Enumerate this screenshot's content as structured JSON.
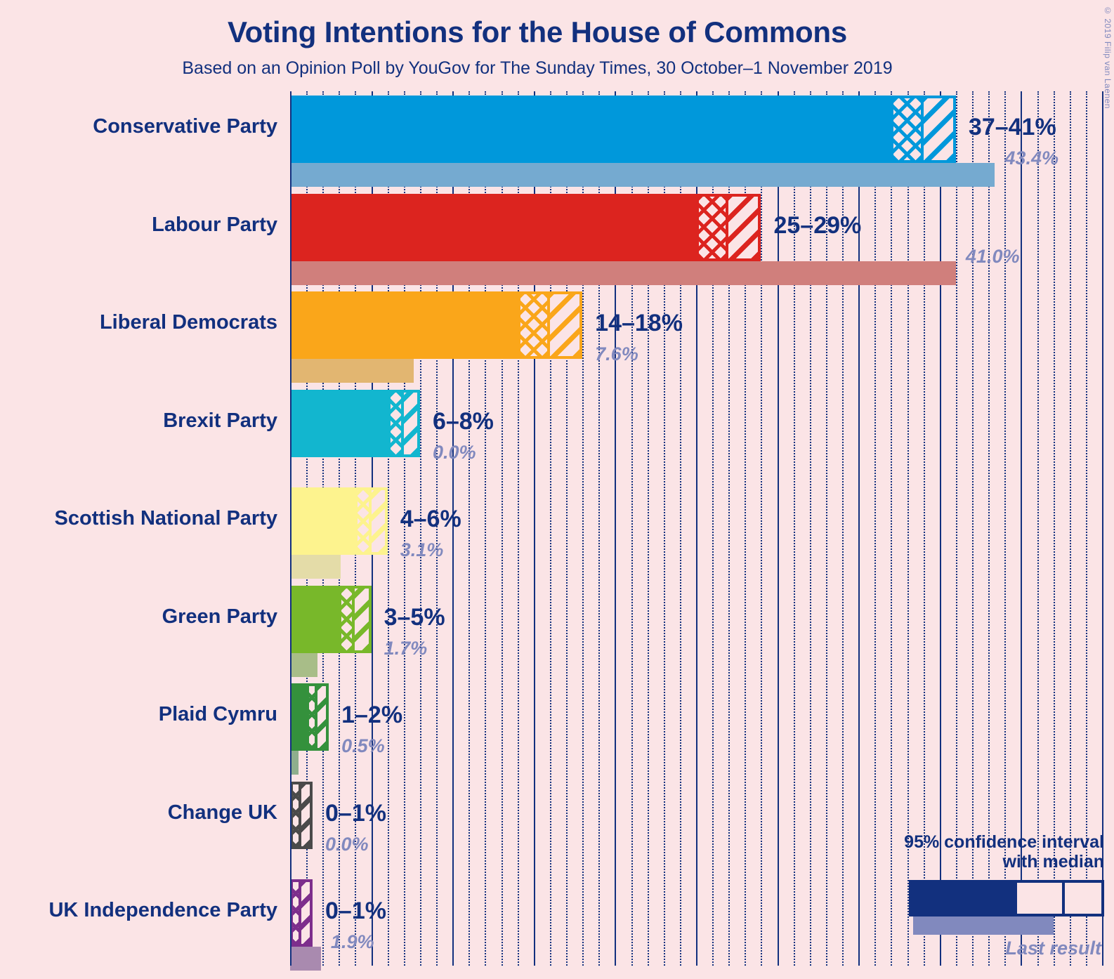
{
  "header": {
    "title": "Voting Intentions for the House of Commons",
    "subtitle": "Based on an Opinion Poll by YouGov for The Sunday Times, 30 October–1 November 2019",
    "copyright": "© 2019 Filip van Laenen"
  },
  "legend": {
    "line1": "95% confidence interval",
    "line2": "with median",
    "last_result_label": "Last result"
  },
  "colors": {
    "background": "#FBE4E6",
    "text": "#12307E",
    "muted_text": "#8189BE",
    "grid": "#12307E"
  },
  "chart_data": {
    "type": "bar",
    "title": "Voting Intentions for the House of Commons",
    "subtitle": "Based on an Opinion Poll by YouGov for The Sunday Times, 30 October–1 November 2019",
    "xlabel": "",
    "ylabel": "",
    "xlim": [
      0,
      50
    ],
    "grid": true,
    "grid_major_step": 5,
    "grid_minor_step": 1,
    "legend_position": "bottom-right",
    "units": "percent",
    "categories": [
      "Conservative Party",
      "Labour Party",
      "Liberal Democrats",
      "Brexit Party",
      "Scottish National Party",
      "Green Party",
      "Plaid Cymru",
      "Change UK",
      "UK Independence Party"
    ],
    "series": [
      {
        "name": "95% confidence interval lower bound",
        "values": [
          37,
          25,
          14,
          6,
          4,
          3,
          1,
          0,
          0
        ]
      },
      {
        "name": "Median",
        "values": [
          39,
          27,
          16,
          7,
          5,
          4,
          1.5,
          0.5,
          0.5
        ]
      },
      {
        "name": "95% confidence interval upper bound",
        "values": [
          41,
          29,
          18,
          8,
          6,
          5,
          2,
          1,
          1
        ]
      },
      {
        "name": "Last result",
        "values": [
          43.4,
          41.0,
          7.6,
          0.0,
          3.1,
          1.7,
          0.5,
          0.0,
          1.9
        ]
      }
    ]
  },
  "rows": [
    {
      "party": "Conservative Party",
      "range_label": "37–41%",
      "last_label": "43.4%",
      "low": 37,
      "median": 39,
      "high": 41,
      "last": 43.4,
      "color": "#0098DB",
      "last_color": "#75AAD0"
    },
    {
      "party": "Labour Party",
      "range_label": "25–29%",
      "last_label": "41.0%",
      "low": 25,
      "median": 27,
      "high": 29,
      "last": 41.0,
      "color": "#DC241F",
      "last_color": "#D07F7C"
    },
    {
      "party": "Liberal Democrats",
      "range_label": "14–18%",
      "last_label": "7.6%",
      "low": 14,
      "median": 16,
      "high": 18,
      "last": 7.6,
      "color": "#FAA61A",
      "last_color": "#E2B671"
    },
    {
      "party": "Brexit Party",
      "range_label": "6–8%",
      "last_label": "0.0%",
      "low": 6,
      "median": 7,
      "high": 8,
      "last": 0.0,
      "color": "#12B6CF",
      "last_color": "#86BECA"
    },
    {
      "party": "Scottish National Party",
      "range_label": "4–6%",
      "last_label": "3.1%",
      "low": 4,
      "median": 5,
      "high": 6,
      "last": 3.1,
      "color": "#FDF38E",
      "last_color": "#E4DCA8"
    },
    {
      "party": "Green Party",
      "range_label": "3–5%",
      "last_label": "1.7%",
      "low": 3,
      "median": 4,
      "high": 5,
      "last": 1.7,
      "color": "#78B82A",
      "last_color": "#A8BD88"
    },
    {
      "party": "Plaid Cymru",
      "range_label": "1–2%",
      "last_label": "0.5%",
      "low": 1,
      "median": 1.5,
      "high": 2,
      "last": 0.5,
      "color": "#34913C",
      "last_color": "#8EAE8D"
    },
    {
      "party": "Change UK",
      "range_label": "0–1%",
      "last_label": "0.0%",
      "low": 0,
      "median": 0.5,
      "high": 1,
      "last": 0.0,
      "color": "#4A4A4A",
      "last_color": "#989898"
    },
    {
      "party": "UK Independence Party",
      "range_label": "0–1%",
      "last_label": "1.9%",
      "low": 0,
      "median": 0.5,
      "high": 1,
      "last": 1.9,
      "color": "#7D2E8C",
      "last_color": "#A98AAF"
    }
  ]
}
